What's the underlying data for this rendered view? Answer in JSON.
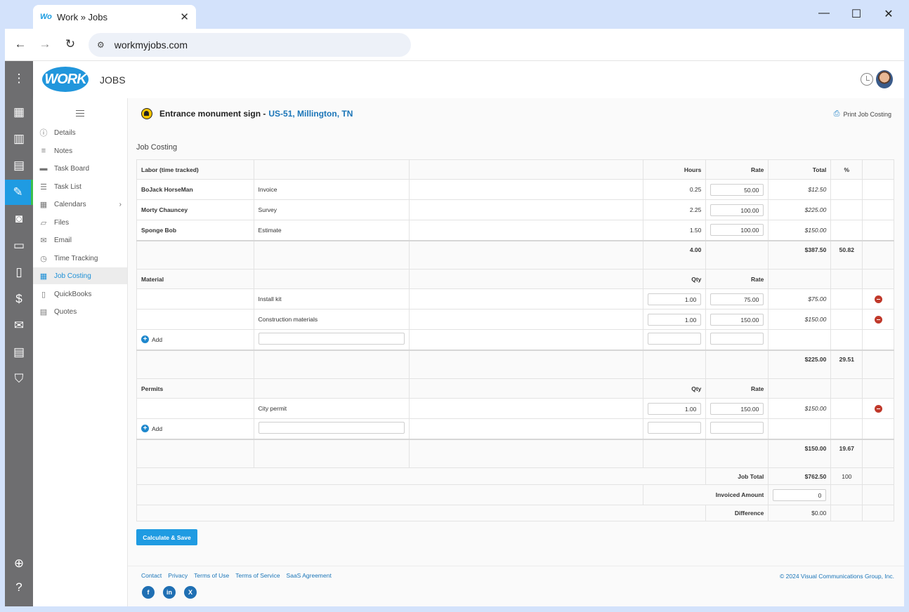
{
  "browser": {
    "tab_title": "Work » Jobs",
    "tab_favicon": "Wo",
    "url": "workmyjobs.com"
  },
  "app": {
    "logo": "WORK",
    "title": "JOBS"
  },
  "sidebar": {
    "items": [
      {
        "label": "Details",
        "icon": "info-icon"
      },
      {
        "label": "Notes",
        "icon": "notes-icon"
      },
      {
        "label": "Task Board",
        "icon": "taskboard-icon"
      },
      {
        "label": "Task List",
        "icon": "tasklist-icon"
      },
      {
        "label": "Calendars",
        "icon": "calendar-icon"
      },
      {
        "label": "Files",
        "icon": "files-icon"
      },
      {
        "label": "Email",
        "icon": "email-icon"
      },
      {
        "label": "Time Tracking",
        "icon": "clock-icon"
      },
      {
        "label": "Job Costing",
        "icon": "costing-icon"
      },
      {
        "label": "QuickBooks",
        "icon": "book-icon"
      },
      {
        "label": "Quotes",
        "icon": "quote-icon"
      }
    ]
  },
  "job": {
    "title": "Entrance monument sign -",
    "location": "US-51, Millington, TN",
    "print_label": "Print Job Costing",
    "section_label": "Job Costing"
  },
  "labor": {
    "header": {
      "label": "Labor (time tracked)",
      "hours": "Hours",
      "rate": "Rate",
      "total": "Total",
      "pct": "%"
    },
    "rows": [
      {
        "name": "BoJack HorseMan",
        "task": "Invoice",
        "hours": "0.25",
        "rate": "50.00",
        "total": "$12.50"
      },
      {
        "name": "Morty Chauncey",
        "task": "Survey",
        "hours": "2.25",
        "rate": "100.00",
        "total": "$225.00"
      },
      {
        "name": "Sponge Bob",
        "task": "Estimate",
        "hours": "1.50",
        "rate": "100.00",
        "total": "$150.00"
      }
    ],
    "sum_hours": "4.00",
    "sum_total": "$387.50",
    "sum_pct": "50.82"
  },
  "material": {
    "header": {
      "label": "Material",
      "qty": "Qty",
      "rate": "Rate"
    },
    "rows": [
      {
        "name": "Install kit",
        "qty": "1.00",
        "rate": "75.00",
        "total": "$75.00"
      },
      {
        "name": "Construction materials",
        "qty": "1.00",
        "rate": "150.00",
        "total": "$150.00"
      }
    ],
    "add_label": "Add",
    "sum_total": "$225.00",
    "sum_pct": "29.51"
  },
  "permits": {
    "header": {
      "label": "Permits",
      "qty": "Qty",
      "rate": "Rate"
    },
    "rows": [
      {
        "name": "City permit",
        "qty": "1.00",
        "rate": "150.00",
        "total": "$150.00"
      }
    ],
    "add_label": "Add",
    "sum_total": "$150.00",
    "sum_pct": "19.67"
  },
  "summary": {
    "job_total_label": "Job Total",
    "job_total": "$762.50",
    "job_total_pct": "100",
    "invoiced_label": "Invoiced Amount",
    "invoiced_value": "0",
    "difference_label": "Difference",
    "difference": "$0.00"
  },
  "actions": {
    "calc_save": "Calculate & Save"
  },
  "footer": {
    "links": [
      "Contact",
      "Privacy",
      "Terms of Use",
      "Terms of Service",
      "SaaS Agreement"
    ],
    "copyright": "© 2024 Visual Communications Group, Inc."
  }
}
